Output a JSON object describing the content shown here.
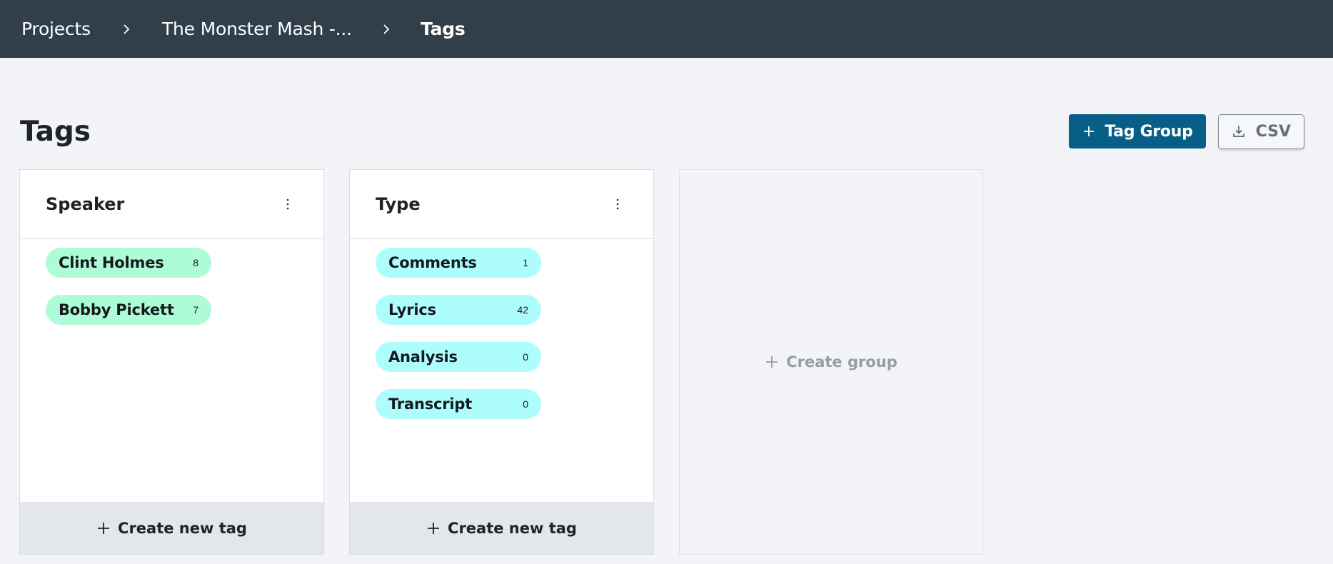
{
  "breadcrumb": {
    "items": [
      {
        "label": "Projects"
      },
      {
        "label": "The Monster Mash -..."
      },
      {
        "label": "Tags"
      }
    ]
  },
  "page": {
    "title": "Tags"
  },
  "actions": {
    "tag_group_label": "Tag Group",
    "csv_label": "CSV"
  },
  "groups": [
    {
      "name": "Speaker",
      "tags": [
        {
          "name": "Clint Holmes",
          "count": "8"
        },
        {
          "name": "Bobby Pickett",
          "count": "7"
        }
      ],
      "create_label": "Create new tag"
    },
    {
      "name": "Type",
      "tags": [
        {
          "name": "Comments",
          "count": "1"
        },
        {
          "name": "Lyrics",
          "count": "42"
        },
        {
          "name": "Analysis",
          "count": "0"
        },
        {
          "name": "Transcript",
          "count": "0"
        }
      ],
      "create_label": "Create new tag"
    }
  ],
  "create_group_label": "Create group",
  "colors": {
    "topbar": "#313f4b",
    "primary": "#075f87",
    "speaker_tag": "#adfcd7",
    "type_tag": "#adfdfd"
  },
  "icons": {
    "breadcrumb_separator": "chevron-right-icon",
    "add": "plus-icon",
    "download": "download-icon",
    "menu": "kebab-menu-icon"
  }
}
